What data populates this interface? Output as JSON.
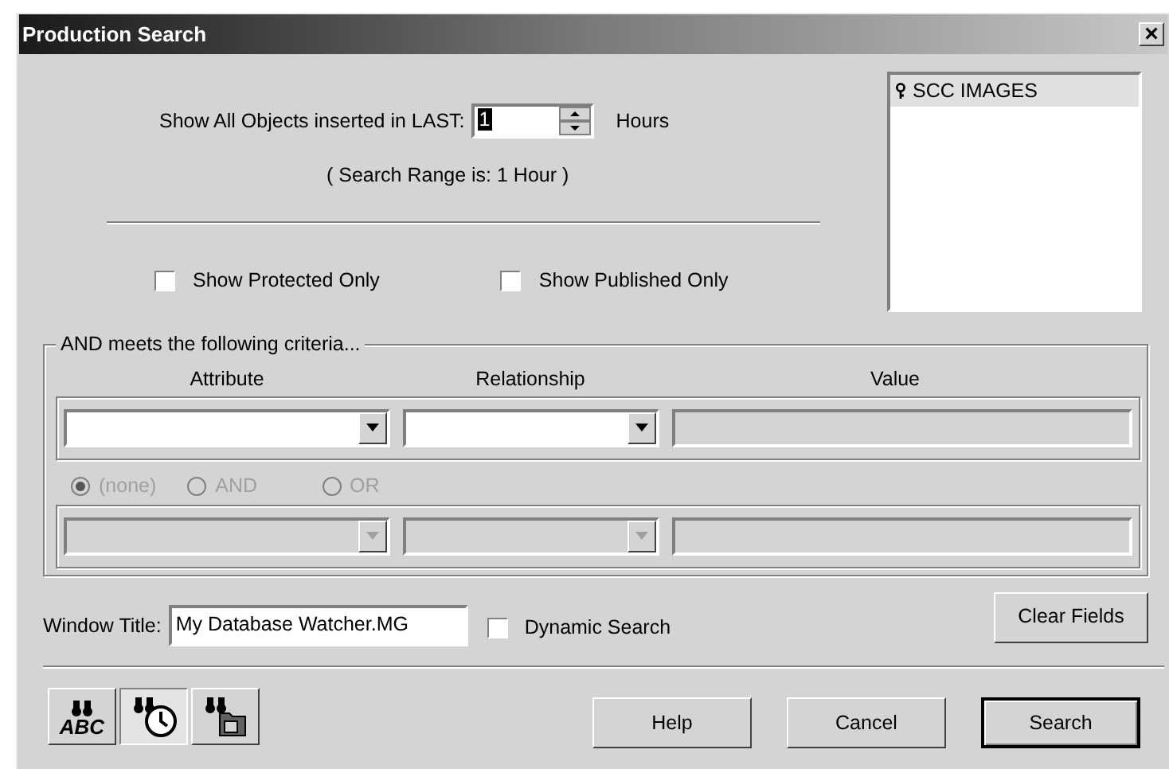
{
  "window": {
    "title": "Production Search",
    "close": "×"
  },
  "time_filter": {
    "label": "Show All Objects inserted in LAST:",
    "value": "1",
    "unit": "Hours",
    "range_note": "( Search Range is: 1 Hour )"
  },
  "options": [
    {
      "label": "Show Protected Only",
      "checked": false
    },
    {
      "label": "Show Published Only",
      "checked": false
    }
  ],
  "databases": [
    {
      "label": "SCC IMAGES",
      "selected": true
    }
  ],
  "criteria": {
    "title": "AND meets the following criteria...",
    "columns": [
      "Attribute",
      "Relationship",
      "Value"
    ],
    "rows": [
      {
        "disabled": false
      },
      {
        "disabled": true
      }
    ],
    "connectors": [
      {
        "label": "(none)",
        "selected": true,
        "disabled": true
      },
      {
        "label": "AND",
        "selected": false,
        "disabled": true
      },
      {
        "label": "OR",
        "selected": false,
        "disabled": true
      }
    ]
  },
  "window_title": {
    "label": "Window Title:",
    "value": "My Database Watcher.MG"
  },
  "dynamic_search": {
    "label": "Dynamic Search",
    "checked": false
  },
  "clear_button": "Clear Fields",
  "modes": [
    {
      "kind": "text",
      "label": "ABC",
      "selected": false
    },
    {
      "kind": "time",
      "selected": true
    },
    {
      "kind": "folder",
      "selected": false
    }
  ],
  "buttons": [
    {
      "label": "Help",
      "default": false
    },
    {
      "label": "Cancel",
      "default": false
    },
    {
      "label": "Search",
      "default": true
    }
  ]
}
